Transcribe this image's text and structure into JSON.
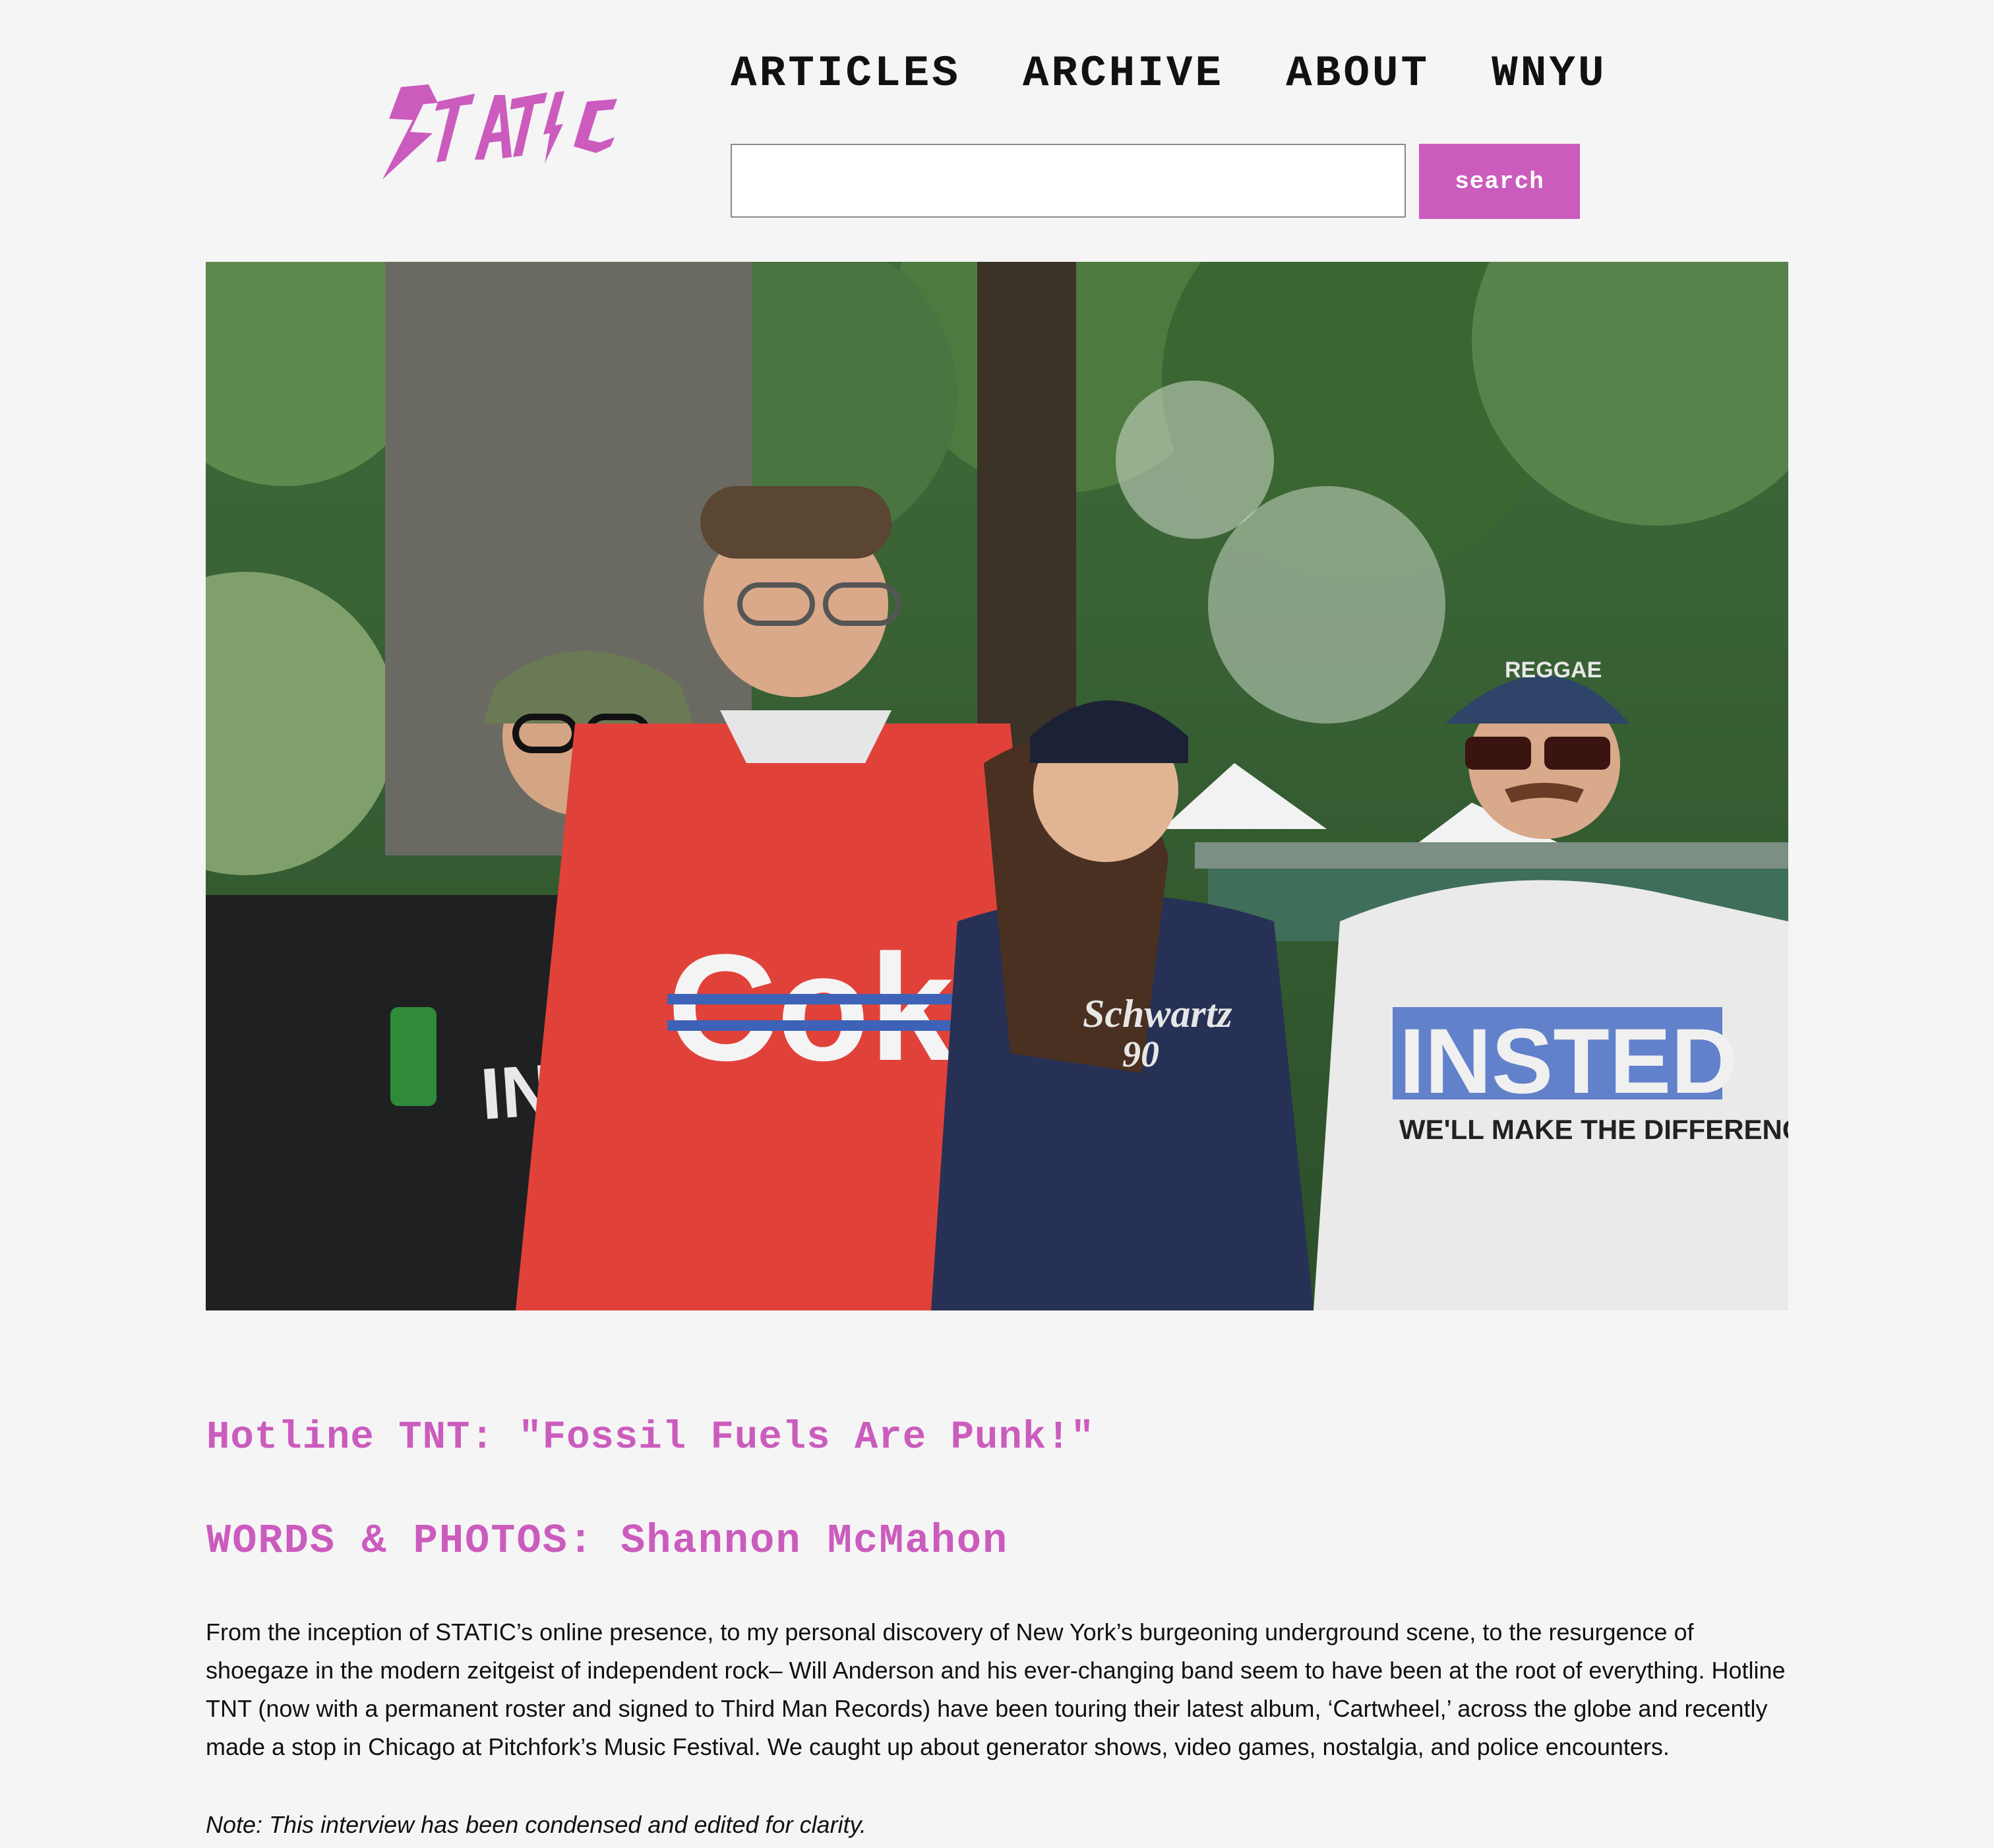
{
  "site": {
    "logo_text": "STATIC",
    "brand_color": "#cb5cbd"
  },
  "nav": {
    "items": [
      {
        "label": "ARTICLES"
      },
      {
        "label": "ARCHIVE"
      },
      {
        "label": "ABOUT"
      },
      {
        "label": "WNYU"
      }
    ]
  },
  "search": {
    "value": "",
    "placeholder": "",
    "button_label": "search"
  },
  "hero": {
    "shirt_prints": [
      "INSTINCT",
      "Coke",
      "Schwartz",
      "90",
      "REGGAE",
      "INSTED",
      "WE'LL MAKE THE DIFFERENCE"
    ]
  },
  "article": {
    "title": "Hotline TNT: \"Fossil Fuels Are Punk!\"",
    "byline_label": "WORDS & PHOTOS:",
    "author": "Shannon McMahon",
    "intro": "From the inception of STATIC’s online presence, to my personal discovery of New York’s burgeoning underground scene, to the resurgence of shoegaze in the modern zeitgeist of independent rock– Will Anderson and his ever-changing band seem to have been at the root of everything. Hotline TNT (now with a permanent roster and signed to Third Man Records) have been touring their latest album, ‘Cartwheel,’ across the globe and recently made a stop in Chicago at Pitchfork’s Music Festival. We caught up about generator shows, video games, nostalgia, and police encounters.",
    "note": "Note: This interview has been condensed and edited for clarity."
  }
}
